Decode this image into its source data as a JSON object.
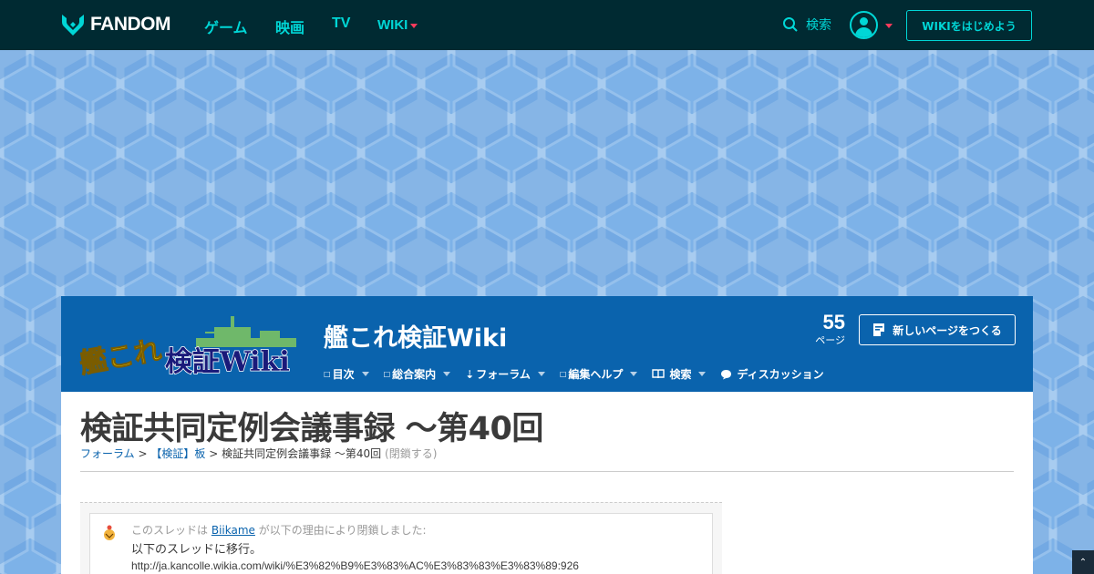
{
  "global_nav": {
    "logo_text": "FANDOM",
    "links": [
      "ゲーム",
      "映画",
      "TV"
    ],
    "wiki_label": "WIKI",
    "search_label": "検索",
    "start_wiki_label": "WIKIをはじめよう"
  },
  "community": {
    "logo_text_line1": "艦これ",
    "logo_text_line2": "検証Wiki",
    "title": "艦これ検証Wiki",
    "page_count": "55",
    "page_count_label": "ページ",
    "new_page_label": "新しいページをつくる",
    "nav": [
      {
        "label": "目次",
        "icon": "list-icon"
      },
      {
        "label": "総合案内",
        "icon": "info-icon"
      },
      {
        "label": "フォーラム",
        "icon": "forum-icon"
      },
      {
        "label": "編集ヘルプ",
        "icon": "help-icon"
      },
      {
        "label": "検索",
        "icon": "book-icon"
      },
      {
        "label": "ディスカッション",
        "icon": "chat-icon"
      }
    ]
  },
  "page": {
    "title": "検証共同定例会議事録 ～第40回",
    "breadcrumb": {
      "forum": "フォーラム",
      "sep": ">",
      "board": "【検証】板",
      "current": "検証共同定例会議事録 ～第40回",
      "status": "(閉鎖する)"
    }
  },
  "notice": {
    "prefix": "このスレッドは",
    "user": "Biikame",
    "suffix": "が以下の理由により閉鎖しました:",
    "message": "以下のスレッドに移行。",
    "url": "http://ja.kancolle.wikia.com/wiki/%E3%82%B9%E3%83%AC%E3%83%83%E3%83%89:926"
  },
  "colors": {
    "global_nav_bg": "#002a32",
    "accent": "#00d6d6",
    "community_bg": "#0a63ad",
    "link": "#0a63ad"
  }
}
